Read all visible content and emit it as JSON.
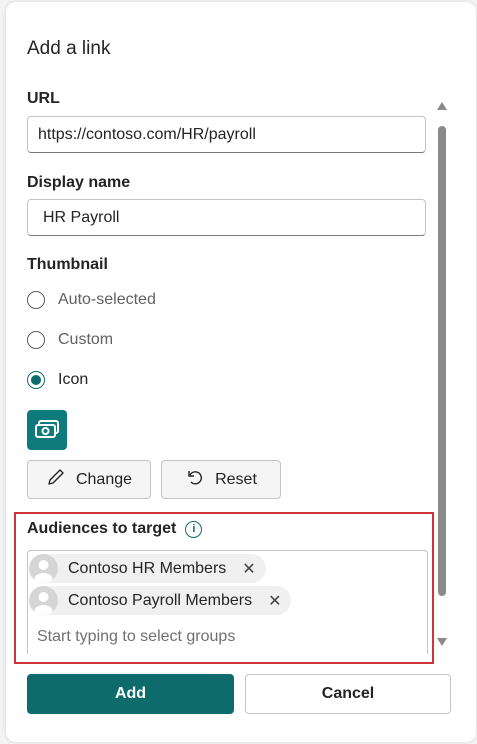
{
  "dialog": {
    "title": "Add a link"
  },
  "url": {
    "label": "URL",
    "value": "https://contoso.com/HR/payroll"
  },
  "display_name": {
    "label": "Display name",
    "value": "HR Payroll"
  },
  "thumbnail": {
    "label": "Thumbnail",
    "options": [
      {
        "label": "Auto-selected",
        "checked": false
      },
      {
        "label": "Custom",
        "checked": false
      },
      {
        "label": "Icon",
        "checked": true
      }
    ],
    "icon_name": "money-icon",
    "change_label": "Change",
    "reset_label": "Reset"
  },
  "audiences": {
    "label": "Audiences to target",
    "chips": [
      {
        "label": "Contoso HR Members"
      },
      {
        "label": "Contoso Payroll Members"
      }
    ],
    "placeholder": "Start typing to select groups"
  },
  "footer": {
    "add_label": "Add",
    "cancel_label": "Cancel"
  },
  "colors": {
    "accent": "#0e6b6b",
    "highlight_border": "#d13438"
  }
}
